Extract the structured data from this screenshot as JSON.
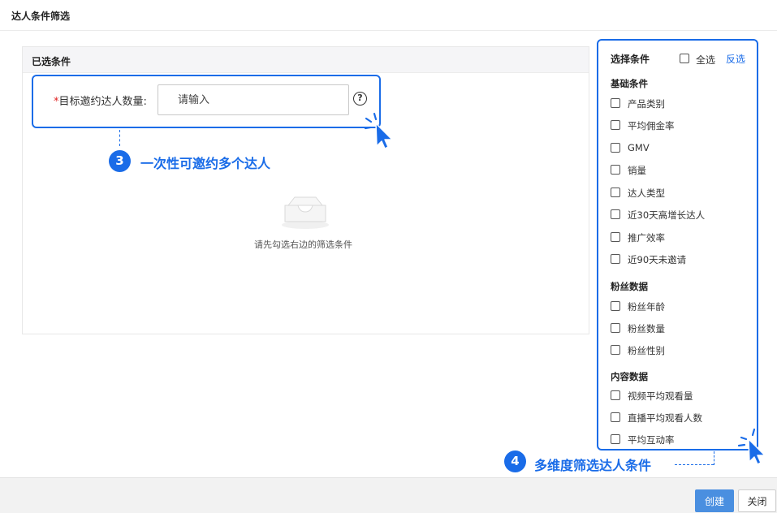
{
  "window": {
    "title": "达人条件筛选"
  },
  "left_panel": {
    "header": "已选条件",
    "field": {
      "required_mark": "*",
      "label": "目标邀约达人数量:",
      "placeholder": "请输入",
      "help_icon": "?"
    },
    "empty_text": "请先勾选右边的筛选条件"
  },
  "callouts": [
    {
      "number": "3",
      "text": "一次性可邀约多个达人"
    },
    {
      "number": "4",
      "text": "多维度筛选达人条件"
    }
  ],
  "right_panel": {
    "header": "选择条件",
    "select_all_label": "全选",
    "invert_label": "反选",
    "groups": [
      {
        "title": "基础条件",
        "items": [
          "产品类别",
          "平均佣金率",
          "GMV",
          "销量",
          "达人类型",
          "近30天高增长达人",
          "推广效率",
          "近90天未邀请"
        ]
      },
      {
        "title": "粉丝数据",
        "items": [
          "粉丝年龄",
          "粉丝数量",
          "粉丝性别"
        ]
      },
      {
        "title": "内容数据",
        "items": [
          "视频平均观看量",
          "直播平均观看人数",
          "平均互动率"
        ]
      }
    ]
  },
  "footer": {
    "create_label": "创建",
    "close_label": "关闭"
  },
  "colors": {
    "accent": "#1a6ce8",
    "primary_button": "#4a8fe0",
    "required": "#e02020"
  },
  "icons": [
    "help-circle-icon",
    "empty-inbox-icon",
    "cursor-click-icon",
    "checkbox-icon"
  ]
}
